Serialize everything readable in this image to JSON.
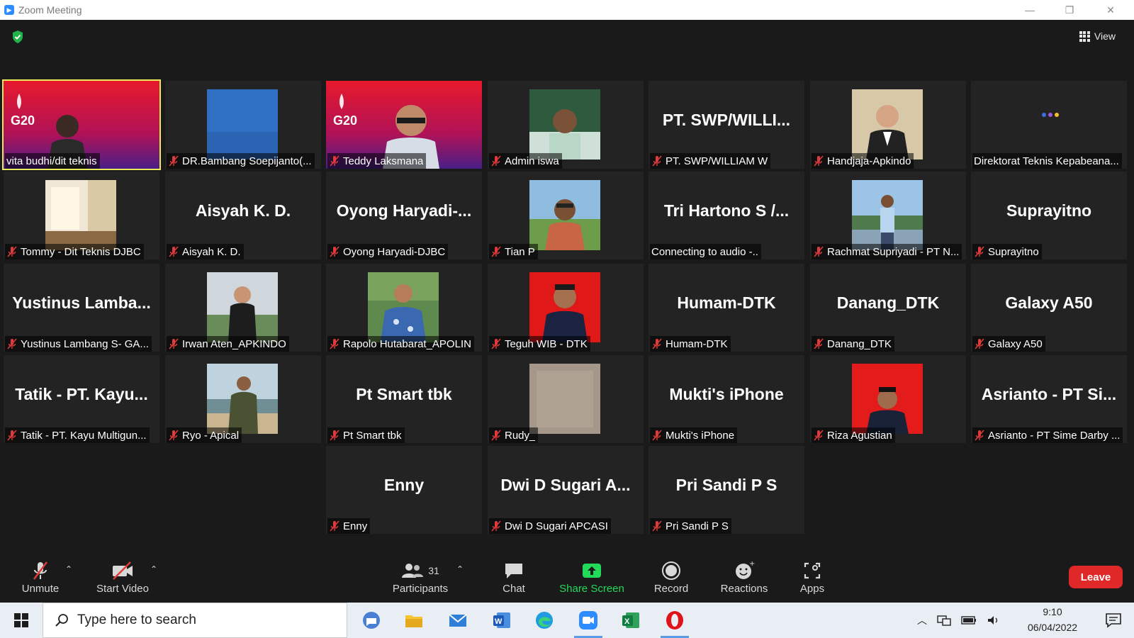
{
  "window": {
    "title": "Zoom Meeting"
  },
  "view_button": "View",
  "tiles": [
    {
      "bigname": "",
      "label": "vita budhi/dit teknis",
      "muted": false,
      "active": true,
      "kind": "g20"
    },
    {
      "bigname": "",
      "label": "DR.Bambang Soepijanto(...",
      "muted": true,
      "kind": "blue"
    },
    {
      "bigname": "",
      "label": "Teddy Laksmana",
      "muted": true,
      "kind": "g20b"
    },
    {
      "bigname": "",
      "label": "Admin iswa",
      "muted": true,
      "kind": "photo-green"
    },
    {
      "bigname": "PT.  SWP/WILLI...",
      "label": "PT. SWP/WILLIAM W",
      "muted": true
    },
    {
      "bigname": "",
      "label": "Handjaja-Apkindo",
      "muted": true,
      "kind": "photo-suit"
    },
    {
      "bigname": "",
      "label": "Direktorat Teknis Kepabeana...",
      "muted": false,
      "kind": "dots"
    },
    {
      "bigname": "",
      "label": "Tommy - Dit Teknis DJBC",
      "muted": true,
      "kind": "photo-room"
    },
    {
      "bigname": "Aisyah K. D.",
      "label": "Aisyah K. D.",
      "muted": true
    },
    {
      "bigname": "Oyong  Haryadi-...",
      "label": "Oyong Haryadi-DJBC",
      "muted": true
    },
    {
      "bigname": "",
      "label": "Tian P",
      "muted": true,
      "kind": "photo-field"
    },
    {
      "bigname": "Tri Hartono S /...",
      "label": "Connecting to audio -..",
      "muted": false
    },
    {
      "bigname": "",
      "label": "Rachmat Supriyadi - PT N...",
      "muted": true,
      "kind": "photo-sky"
    },
    {
      "bigname": "Suprayitno",
      "label": "Suprayitno",
      "muted": true
    },
    {
      "bigname": "Yustinus  Lamba...",
      "label": "Yustinus Lambang S- GA...",
      "muted": true
    },
    {
      "bigname": "",
      "label": "Irwan Aten_APKINDO",
      "muted": true,
      "kind": "photo-suit2"
    },
    {
      "bigname": "",
      "label": "Rapolo Hutabarat_APOLIN",
      "muted": true,
      "kind": "photo-batik"
    },
    {
      "bigname": "",
      "label": "Teguh WIB - DTK",
      "muted": true,
      "kind": "photo-red"
    },
    {
      "bigname": "Humam-DTK",
      "label": "Humam-DTK",
      "muted": true
    },
    {
      "bigname": "Danang_DTK",
      "label": "Danang_DTK",
      "muted": true
    },
    {
      "bigname": "Galaxy A50",
      "label": "Galaxy A50",
      "muted": true
    },
    {
      "bigname": "Tatik  -  PT.  Kayu...",
      "label": "Tatik - PT. Kayu Multigun...",
      "muted": true
    },
    {
      "bigname": "",
      "label": "Ryo - Apical",
      "muted": true,
      "kind": "photo-beach"
    },
    {
      "bigname": "Pt Smart tbk",
      "label": "Pt Smart tbk",
      "muted": true
    },
    {
      "bigname": "",
      "label": "Rudy_",
      "muted": true,
      "kind": "photo-blur"
    },
    {
      "bigname": "Mukti's iPhone",
      "label": "Mukti's iPhone",
      "muted": true
    },
    {
      "bigname": "",
      "label": "Riza Agustian",
      "muted": true,
      "kind": "photo-red2"
    },
    {
      "bigname": "Asrianto  -  PT  Si...",
      "label": "Asrianto - PT Sime Darby ...",
      "muted": true
    },
    {
      "bigname": "Enny",
      "label": "Enny",
      "muted": true
    },
    {
      "bigname": "Dwi  D  Sugari  A...",
      "label": "Dwi D Sugari APCASI",
      "muted": true
    },
    {
      "bigname": "Pri Sandi P S",
      "label": "Pri Sandi P S",
      "muted": true
    }
  ],
  "toolbar": {
    "unmute": "Unmute",
    "start_video": "Start Video",
    "participants": "Participants",
    "participant_count": "31",
    "chat": "Chat",
    "share_screen": "Share Screen",
    "record": "Record",
    "reactions": "Reactions",
    "apps": "Apps",
    "leave": "Leave"
  },
  "taskbar": {
    "search_placeholder": "Type here to search",
    "time": "9:10",
    "date": "06/04/2022"
  },
  "colors": {
    "accent_share": "#23d959",
    "leave": "#e02828",
    "active_speaker": "#e8e95b",
    "muted_mic": "#e03a3a"
  }
}
